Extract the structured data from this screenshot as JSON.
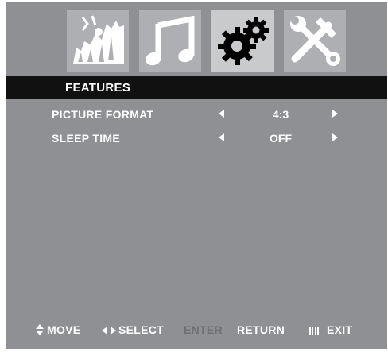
{
  "tabs": [
    {
      "name": "picture",
      "icon": "mountains-icon",
      "active": false
    },
    {
      "name": "audio",
      "icon": "music-note-icon",
      "active": false
    },
    {
      "name": "features",
      "icon": "gear-icon",
      "active": true
    },
    {
      "name": "setup",
      "icon": "wrench-hammer-icon",
      "active": false
    }
  ],
  "menu": {
    "title": "FEATURES",
    "items": [
      {
        "label": "PICTURE FORMAT",
        "value": "4:3"
      },
      {
        "label": "SLEEP TIME",
        "value": "OFF"
      }
    ]
  },
  "footer": {
    "move": "MOVE",
    "select": "SELECT",
    "enter": "ENTER",
    "return": "RETURN",
    "exit": "EXIT"
  },
  "colors": {
    "panel": "#8f9093",
    "tab": "#aeafb3",
    "tab_active": "#c9cacc",
    "title_bar": "#111111",
    "text": "#ffffff",
    "dim_text": "#6e6f72"
  }
}
